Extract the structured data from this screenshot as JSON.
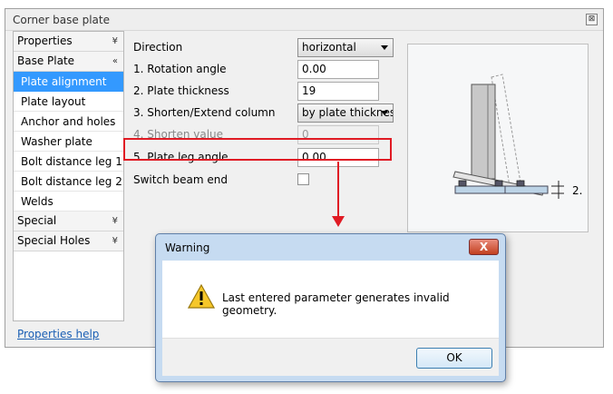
{
  "window": {
    "title": "Corner base plate",
    "close_glyph": "⊠"
  },
  "sidebar": {
    "sections": [
      {
        "label": "Properties",
        "chevron": "¥"
      },
      {
        "label": "Base Plate",
        "chevron": "«"
      }
    ],
    "items": [
      {
        "label": "Plate alignment"
      },
      {
        "label": "Plate layout"
      },
      {
        "label": "Anchor and holes"
      },
      {
        "label": "Washer plate"
      },
      {
        "label": "Bolt distance leg 1"
      },
      {
        "label": "Bolt distance leg 2"
      },
      {
        "label": "Welds"
      }
    ],
    "sections_after": [
      {
        "label": "Special",
        "chevron": "¥"
      },
      {
        "label": "Special Holes",
        "chevron": "¥"
      }
    ]
  },
  "help_link": "Properties help",
  "form": {
    "direction": {
      "label": "Direction",
      "value": "horizontal"
    },
    "rotation_angle": {
      "label": "1. Rotation angle",
      "value": "0.00"
    },
    "plate_thickness": {
      "label": "2. Plate thickness",
      "value": "19"
    },
    "shorten_extend": {
      "label": "3. Shorten/Extend column",
      "value": "by plate thickness"
    },
    "shorten_value": {
      "label": "4. Shorten value",
      "value": "0"
    },
    "plate_leg_angle": {
      "label": "5. Plate leg angle",
      "value": "0.00"
    },
    "switch_beam_end": {
      "label": "Switch beam end",
      "checked": false
    }
  },
  "preview": {
    "dimension_label": "2."
  },
  "warning": {
    "title": "Warning",
    "close_label": "X",
    "message": "Last entered parameter generates invalid geometry.",
    "ok_label": "OK",
    "icon": "warning-triangle-icon"
  },
  "colors": {
    "selection": "#3399ff",
    "highlight": "#e01b24",
    "link": "#1a5fb4"
  }
}
